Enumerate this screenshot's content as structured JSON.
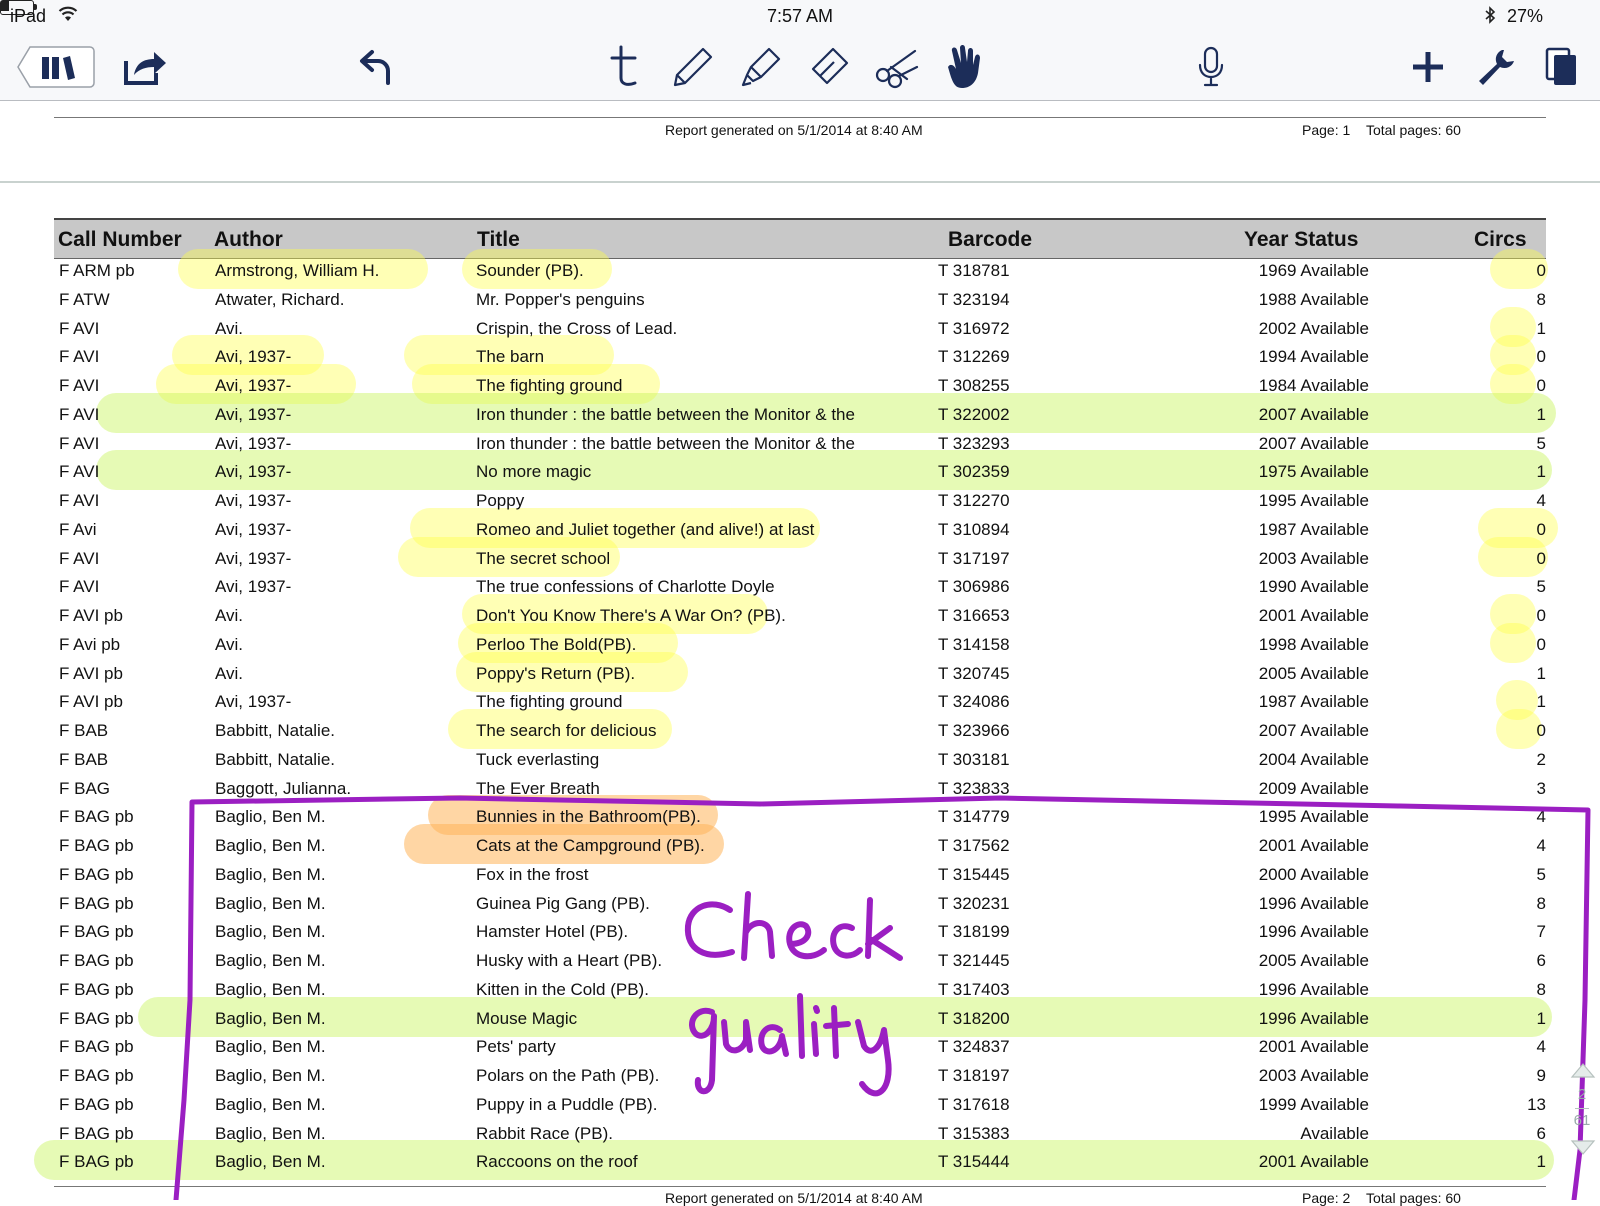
{
  "status_bar": {
    "device": "iPad",
    "time": "7:57 AM",
    "battery": "27%",
    "battery_level": 0.27
  },
  "toolbar": {
    "left": [
      "library-icon",
      "share-icon",
      "undo-icon"
    ],
    "center": [
      "text-tool-icon",
      "pen-icon",
      "highlighter-icon",
      "eraser-icon",
      "scissors-icon",
      "hand-icon"
    ],
    "right": [
      "microphone-icon",
      "plus-icon",
      "wrench-icon",
      "pages-icon"
    ],
    "accent_color": "#1c2d59"
  },
  "report": {
    "generated": "Report generated on 5/1/2014 at 8:40 AM",
    "page_label": "Page: 1",
    "total_pages": "Total pages: 60",
    "next_page_generated": "Report generated on 5/1/2014 at 8:40 AM",
    "next_page_label": "Page: 2",
    "next_total_pages": "Total pages: 60"
  },
  "table": {
    "headers": {
      "call_number": "Call Number",
      "author": "Author",
      "title": "Title",
      "barcode": "Barcode",
      "year_status": "Year Status",
      "circs": "Circs"
    },
    "rows": [
      {
        "call": "F ARM pb",
        "author": "Armstrong, William H.",
        "title": "Sounder (PB).",
        "barcode": "T 318781",
        "year": "1969",
        "status": "Available",
        "circs": "0"
      },
      {
        "call": "F ATW",
        "author": "Atwater, Richard.",
        "title": "Mr. Popper's penguins",
        "barcode": "T 323194",
        "year": "1988",
        "status": "Available",
        "circs": "8"
      },
      {
        "call": "F AVI",
        "author": "Avi.",
        "title": "Crispin, the Cross of Lead.",
        "barcode": "T 316972",
        "year": "2002",
        "status": "Available",
        "circs": "1"
      },
      {
        "call": "F AVI",
        "author": "Avi, 1937-",
        "title": "The barn",
        "barcode": "T 312269",
        "year": "1994",
        "status": "Available",
        "circs": "0"
      },
      {
        "call": "F AVI",
        "author": "Avi, 1937-",
        "title": "The fighting ground",
        "barcode": "T 308255",
        "year": "1984",
        "status": "Available",
        "circs": "0"
      },
      {
        "call": "F AVI",
        "author": "Avi, 1937-",
        "title": "Iron thunder : the battle between the Monitor & the",
        "barcode": "T 322002",
        "year": "2007",
        "status": "Available",
        "circs": "1"
      },
      {
        "call": "F AVI",
        "author": "Avi, 1937-",
        "title": "Iron thunder : the battle between the Monitor & the",
        "barcode": "T 323293",
        "year": "2007",
        "status": "Available",
        "circs": "5"
      },
      {
        "call": "F AVI",
        "author": "Avi, 1937-",
        "title": "No more magic",
        "barcode": "T 302359",
        "year": "1975",
        "status": "Available",
        "circs": "1"
      },
      {
        "call": "F AVI",
        "author": "Avi, 1937-",
        "title": "Poppy",
        "barcode": "T 312270",
        "year": "1995",
        "status": "Available",
        "circs": "4"
      },
      {
        "call": "F Avi",
        "author": "Avi, 1937-",
        "title": "Romeo and Juliet together (and alive!) at last",
        "barcode": "T 310894",
        "year": "1987",
        "status": "Available",
        "circs": "0"
      },
      {
        "call": "F AVI",
        "author": "Avi, 1937-",
        "title": "The secret school",
        "barcode": "T 317197",
        "year": "2003",
        "status": "Available",
        "circs": "0"
      },
      {
        "call": "F AVI",
        "author": "Avi, 1937-",
        "title": "The true confessions of Charlotte Doyle",
        "barcode": "T 306986",
        "year": "1990",
        "status": "Available",
        "circs": "5"
      },
      {
        "call": "F AVI pb",
        "author": "Avi.",
        "title": "Don't You Know There's A War On? (PB).",
        "barcode": "T 316653",
        "year": "2001",
        "status": "Available",
        "circs": "0"
      },
      {
        "call": "F Avi pb",
        "author": "Avi.",
        "title": "Perloo The Bold(PB).",
        "barcode": "T 314158",
        "year": "1998",
        "status": "Available",
        "circs": "0"
      },
      {
        "call": "F AVI pb",
        "author": "Avi.",
        "title": "Poppy's Return (PB).",
        "barcode": "T 320745",
        "year": "2005",
        "status": "Available",
        "circs": "1"
      },
      {
        "call": "F AVI pb",
        "author": "Avi, 1937-",
        "title": "The fighting ground",
        "barcode": "T 324086",
        "year": "1987",
        "status": "Available",
        "circs": "1"
      },
      {
        "call": "F BAB",
        "author": "Babbitt, Natalie.",
        "title": "The search for delicious",
        "barcode": "T 323966",
        "year": "2007",
        "status": "Available",
        "circs": "0"
      },
      {
        "call": "F BAB",
        "author": "Babbitt, Natalie.",
        "title": "Tuck everlasting",
        "barcode": "T 303181",
        "year": "2004",
        "status": "Available",
        "circs": "2"
      },
      {
        "call": "F BAG",
        "author": "Baggott, Julianna.",
        "title": "The Ever Breath",
        "barcode": "T 323833",
        "year": "2009",
        "status": "Available",
        "circs": "3"
      },
      {
        "call": "F BAG pb",
        "author": "Baglio, Ben M.",
        "title": "Bunnies in the Bathroom(PB).",
        "barcode": "T 314779",
        "year": "1995",
        "status": "Available",
        "circs": "4"
      },
      {
        "call": "F BAG pb",
        "author": "Baglio, Ben M.",
        "title": "Cats at the Campground (PB).",
        "barcode": "T 317562",
        "year": "2001",
        "status": "Available",
        "circs": "4"
      },
      {
        "call": "F BAG pb",
        "author": "Baglio, Ben M.",
        "title": "Fox in the frost",
        "barcode": "T 315445",
        "year": "2000",
        "status": "Available",
        "circs": "5"
      },
      {
        "call": "F BAG pb",
        "author": "Baglio, Ben M.",
        "title": "Guinea Pig Gang (PB).",
        "barcode": "T 320231",
        "year": "1996",
        "status": "Available",
        "circs": "8"
      },
      {
        "call": "F BAG pb",
        "author": "Baglio, Ben M.",
        "title": "Hamster Hotel (PB).",
        "barcode": "T 318199",
        "year": "1996",
        "status": "Available",
        "circs": "7"
      },
      {
        "call": "F BAG pb",
        "author": "Baglio, Ben M.",
        "title": "Husky with a Heart (PB).",
        "barcode": "T 321445",
        "year": "2005",
        "status": "Available",
        "circs": "6"
      },
      {
        "call": "F BAG pb",
        "author": "Baglio, Ben M.",
        "title": "Kitten in the Cold (PB).",
        "barcode": "T 317403",
        "year": "1996",
        "status": "Available",
        "circs": "8"
      },
      {
        "call": "F BAG pb",
        "author": "Baglio, Ben M.",
        "title": "Mouse Magic",
        "barcode": "T 318200",
        "year": "1996",
        "status": "Available",
        "circs": "1"
      },
      {
        "call": "F BAG pb",
        "author": "Baglio, Ben M.",
        "title": "Pets' party",
        "barcode": "T 324837",
        "year": "2001",
        "status": "Available",
        "circs": "4"
      },
      {
        "call": "F BAG pb",
        "author": "Baglio, Ben M.",
        "title": "Polars on the Path (PB).",
        "barcode": "T 318197",
        "year": "2003",
        "status": "Available",
        "circs": "9"
      },
      {
        "call": "F BAG pb",
        "author": "Baglio, Ben M.",
        "title": "Puppy in a Puddle (PB).",
        "barcode": "T 317618",
        "year": "1999",
        "status": "Available",
        "circs": "13"
      },
      {
        "call": "F BAG pb",
        "author": "Baglio, Ben M.",
        "title": "Rabbit Race (PB).",
        "barcode": "T 315383",
        "year": "",
        "status": "Available",
        "circs": "6"
      },
      {
        "call": "F BAG pb",
        "author": "Baglio, Ben M.",
        "title": "Raccoons on the roof",
        "barcode": "T 315444",
        "year": "2001",
        "status": "Available",
        "circs": "1"
      }
    ]
  },
  "annotations": {
    "handwriting": "Check quality",
    "ink_color": "#9b1fc2",
    "highlight_colors": {
      "yellow": "#ffff46",
      "green": "#c8f55a",
      "orange": "#ffb45a"
    }
  },
  "scroll": {
    "current": "2",
    "total": "61"
  }
}
